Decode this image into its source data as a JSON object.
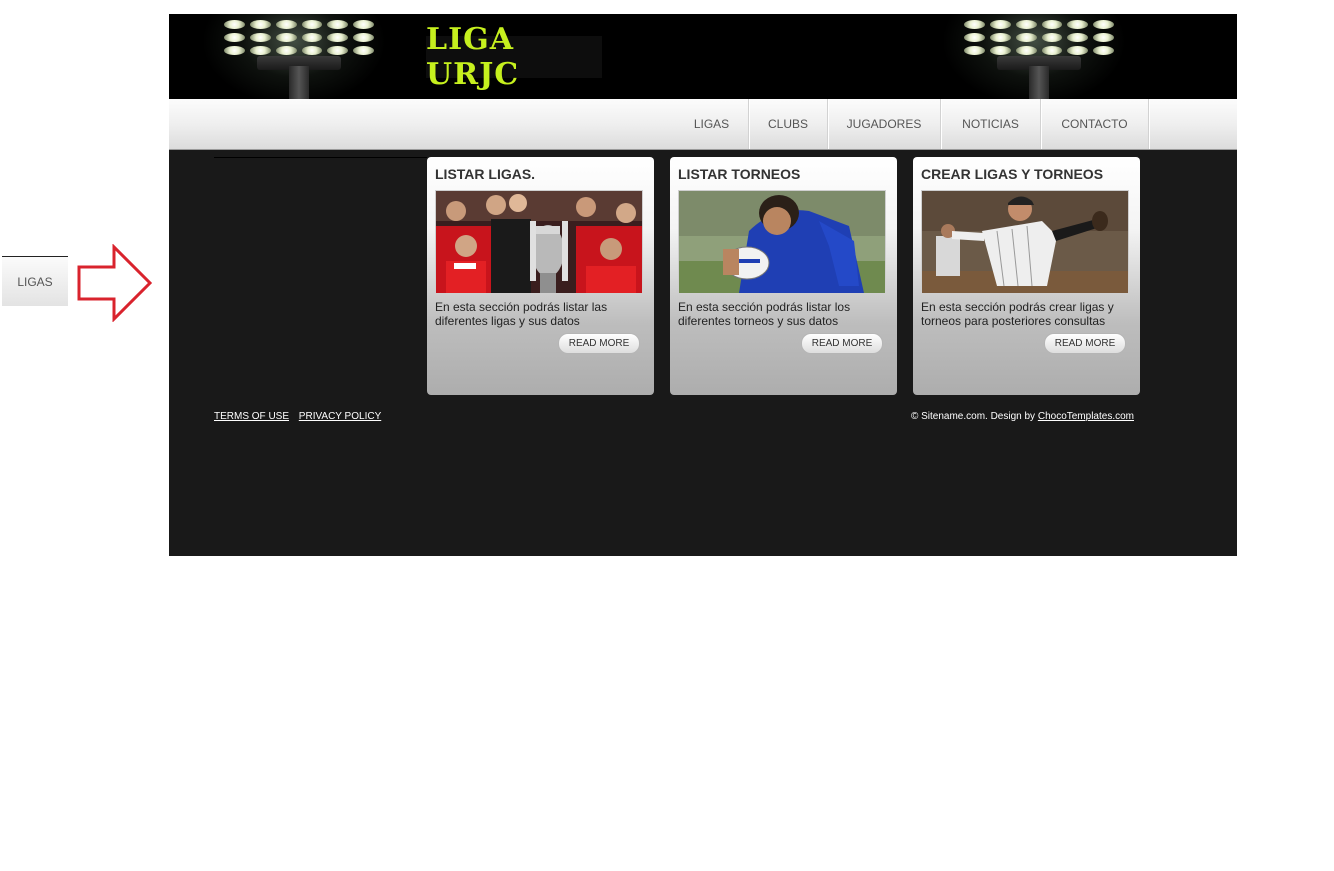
{
  "annotation": {
    "side_tab_label": "LIGAS",
    "arrow_color": "#d9232d"
  },
  "header": {
    "logo_text": "LIGA URJC",
    "logo_color": "#c6f01e"
  },
  "nav": {
    "items": [
      {
        "label": "LIGAS"
      },
      {
        "label": "CLUBS"
      },
      {
        "label": "JUGADORES"
      },
      {
        "label": "NOTICIAS"
      },
      {
        "label": "CONTACTO"
      }
    ]
  },
  "cards": [
    {
      "title": "LISTAR LIGAS.",
      "image": "trophy-celebration-photo",
      "text": "En esta sección podrás listar las diferentes ligas y sus datos",
      "button": "READ MORE"
    },
    {
      "title": "LISTAR TORNEOS",
      "image": "rugby-player-photo",
      "text": "En esta sección podrás listar los diferentes torneos y sus datos",
      "button": "READ MORE"
    },
    {
      "title": "CREAR LIGAS Y TORNEOS",
      "image": "baseball-pitcher-photo",
      "text": "En esta sección podrás crear ligas y torneos para posteriores consultas",
      "button": "READ MORE"
    }
  ],
  "footer": {
    "terms": "TERMS OF USE",
    "privacy": "PRIVACY POLICY",
    "credits_prefix": "© Sitename.com. Design by ",
    "credits_link": "ChocoTemplates.com"
  }
}
